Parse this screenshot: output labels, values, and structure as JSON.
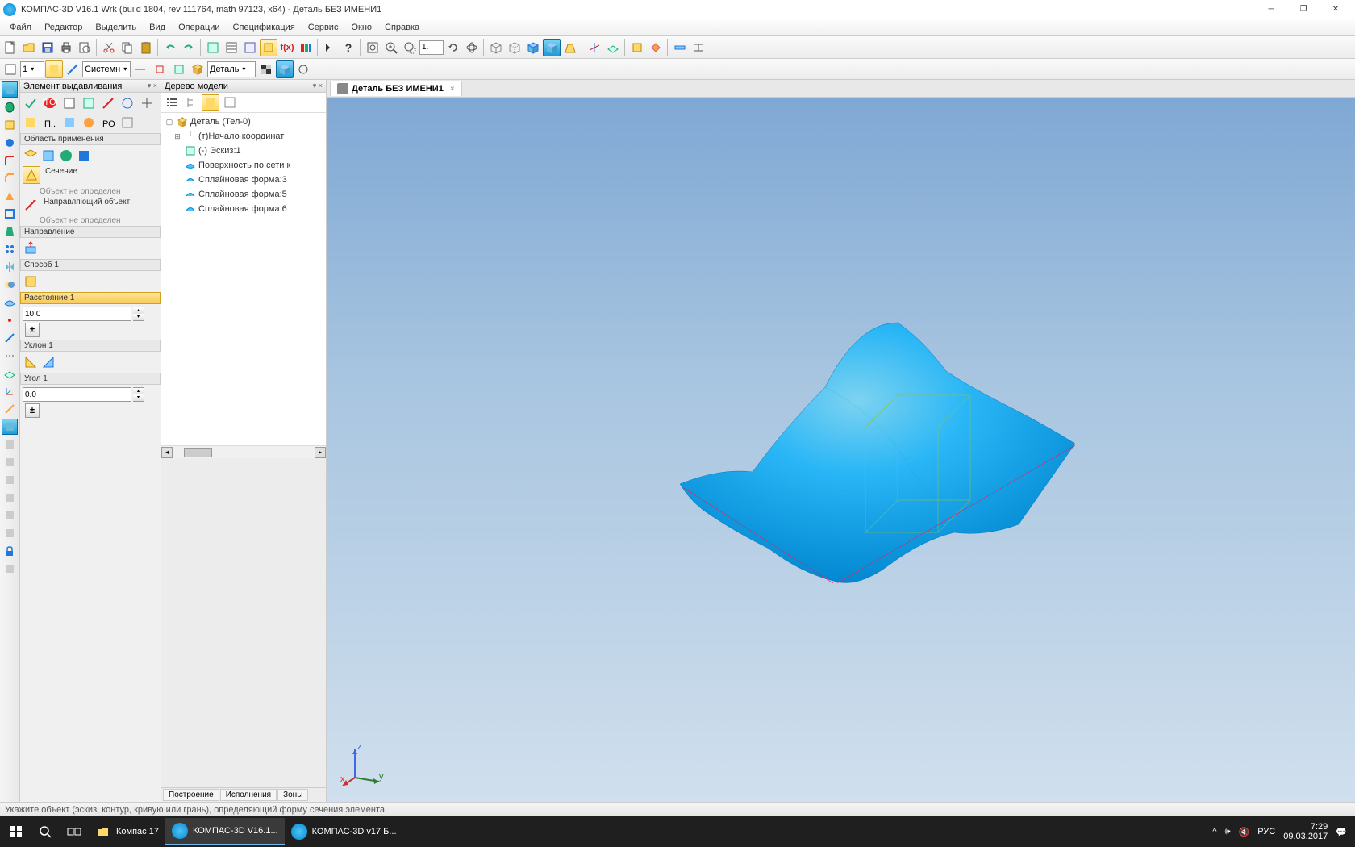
{
  "title": "КОМПАС-3D V16.1 Wrk (build 1804, rev 111764, math 97123, x64) - Деталь БЕЗ ИМЕНИ1",
  "menus": [
    "Файл",
    "Редактор",
    "Выделить",
    "Вид",
    "Операции",
    "Спецификация",
    "Сервис",
    "Окно",
    "Справка"
  ],
  "doc_tab": "Деталь БЕЗ ИМЕНИ1",
  "toolbar2": {
    "num": "1",
    "combo1": "Системн",
    "combo2": "Деталь"
  },
  "zoom": "1.",
  "prop": {
    "title": "Элемент выдавливания",
    "scope": "Область применения",
    "section": "Сечение",
    "obj_undef1": "Объект не определен",
    "guide_obj": "Направляющий объект",
    "obj_undef2": "Объект не определен",
    "direction": "Направление",
    "method": "Способ 1",
    "distance": "Расстояние 1",
    "distance_val": "10.0",
    "slope": "Уклон 1",
    "angle": "Угол 1",
    "angle_val": "0.0"
  },
  "tree": {
    "title": "Дерево модели",
    "root": "Деталь (Тел-0)",
    "items": [
      "(т)Начало координат",
      "(-) Эскиз:1",
      "Поверхность по сети к",
      "Сплайновая форма:3",
      "Сплайновая форма:5",
      "Сплайновая форма:6"
    ],
    "tabs": [
      "Построение",
      "Исполнения",
      "Зоны"
    ]
  },
  "triad": {
    "x": "x",
    "y": "y",
    "z": "z"
  },
  "status": "Укажите объект (эскиз, контур, кривую или грань), определяющий форму сечения элемента",
  "taskbar": {
    "folder": "Компас 17",
    "app1": "КОМПАС-3D V16.1...",
    "app2": "КОМПАС-3D v17 Б...",
    "lang": "РУС",
    "time": "7:29",
    "date": "09.03.2017"
  }
}
